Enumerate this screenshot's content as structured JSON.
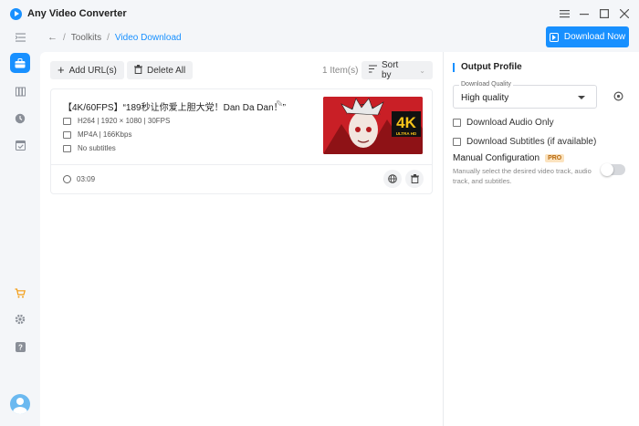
{
  "app": {
    "title": "Any Video Converter"
  },
  "window_controls": [
    "menu-icon",
    "minimize-icon",
    "maximize-icon",
    "close-icon"
  ],
  "sidebar": {
    "items": [
      {
        "icon": "collapse-menu-icon",
        "active": false
      },
      {
        "icon": "toolkit-icon",
        "active": true
      },
      {
        "icon": "library-icon",
        "active": false
      },
      {
        "icon": "history-icon",
        "active": false
      },
      {
        "icon": "tasks-icon",
        "active": false
      }
    ],
    "bottom": [
      {
        "icon": "cart-icon"
      },
      {
        "icon": "settings-icon"
      },
      {
        "icon": "help-icon"
      }
    ]
  },
  "breadcrumb": {
    "root": "Toolkits",
    "separator": "/",
    "current": "Video Download"
  },
  "header": {
    "download_now": "Download Now"
  },
  "toolbar": {
    "add_url": "Add URL(s)",
    "delete_all": "Delete All",
    "items_count": "1 Item(s)",
    "sort_by": "Sort by"
  },
  "video": {
    "title": "【4K/60FPS】“189秒让你爱上胆大党！Dan Da Dan！”",
    "video_info": "H264 | 1920 × 1080 | 30FPS",
    "audio_info": "MP4A | 166Kbps",
    "subtitles_info": "No subtitles",
    "duration": "03:09",
    "thumbnail_badge_top": "4K",
    "thumbnail_badge_bottom": "ULTRA HD"
  },
  "output_profile": {
    "title": "Output Profile",
    "quality_label": "Download Quality",
    "quality_value": "High quality",
    "download_audio_only": "Download Audio Only",
    "download_subtitles": "Download Subtitles (if available)",
    "manual_config_label": "Manual Configuration",
    "pro_badge": "PRO",
    "manual_config_desc": "Manually select the desired video track, audio track, and subtitles.",
    "manual_config_enabled": false
  },
  "colors": {
    "accent": "#1890ff",
    "pro_bg": "#fbe3bf",
    "pro_text": "#b8690e"
  }
}
